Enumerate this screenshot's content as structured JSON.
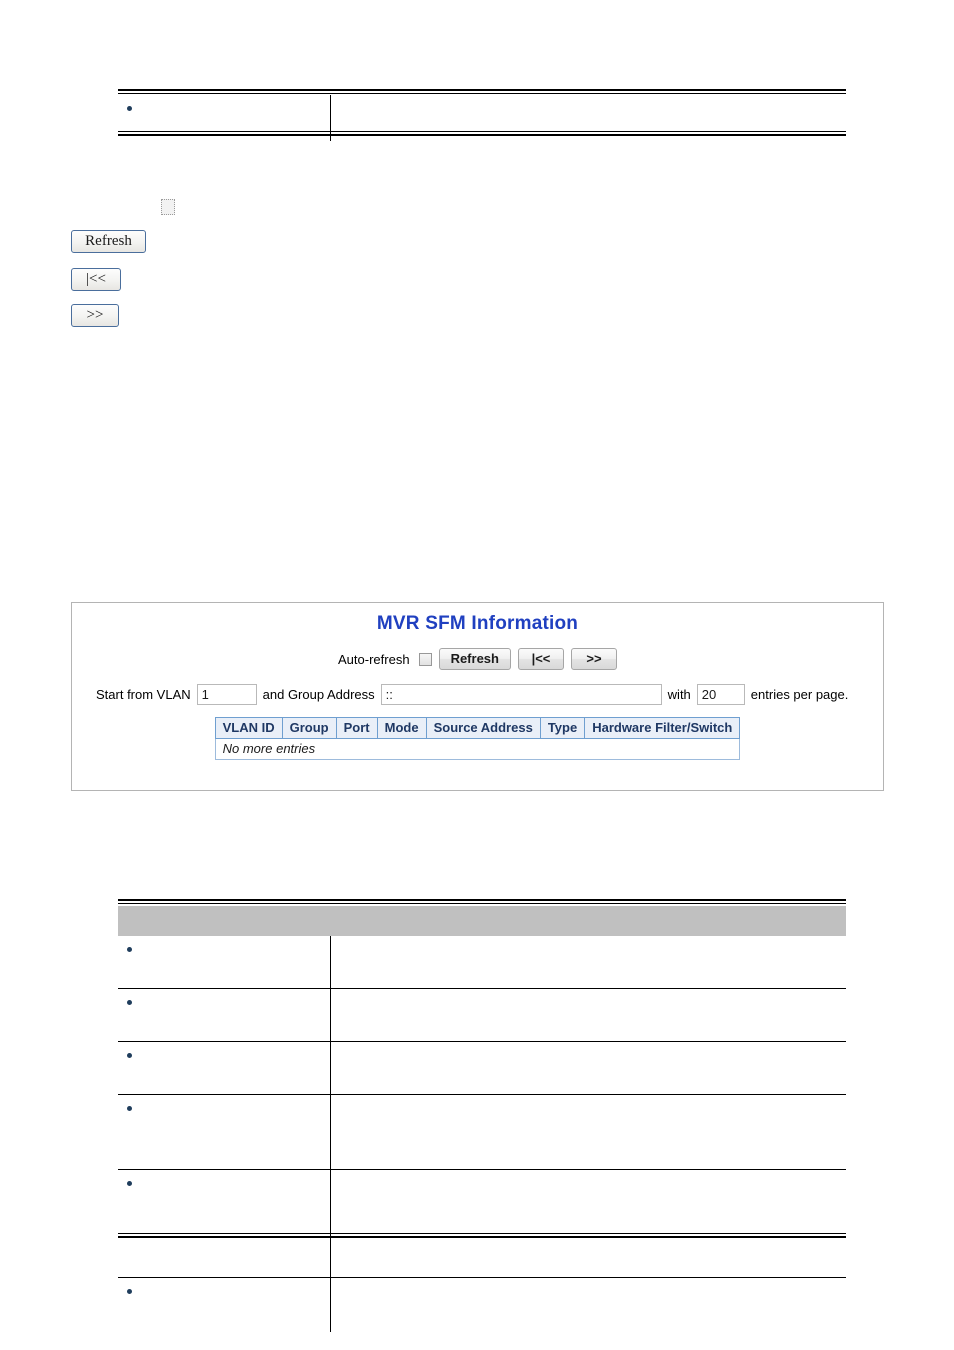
{
  "top_table": {
    "columns": [
      "",
      ""
    ],
    "rows": [
      {
        "label": "",
        "description": ""
      }
    ]
  },
  "top_controls": {
    "auto_refresh_checkbox": {
      "checked": false
    },
    "buttons": [
      {
        "name": "refresh",
        "label": "Refresh"
      },
      {
        "name": "first-page",
        "label": "|<<"
      },
      {
        "name": "next-page",
        "label": ">>"
      }
    ]
  },
  "mvr_panel": {
    "title": "MVR SFM Information",
    "toolbar": {
      "auto_refresh_label": "Auto-refresh",
      "auto_refresh_checked": false,
      "refresh_label": "Refresh",
      "first_label": "|<<",
      "next_label": ">>"
    },
    "filter_row": {
      "start_label": "Start from VLAN",
      "vlan_value": "1",
      "group_label": "and Group Address",
      "group_value": "::",
      "with_label": "with",
      "entries_value": "20",
      "entries_suffix": "entries per page."
    },
    "table": {
      "headers": [
        "VLAN ID",
        "Group",
        "Port",
        "Mode",
        "Source Address",
        "Type",
        "Hardware Filter/Switch"
      ],
      "empty_message": "No more entries"
    }
  },
  "bottom_table": {
    "header": {
      "col1": "",
      "col2": ""
    },
    "rows": [
      {
        "label": "",
        "description": ""
      },
      {
        "label": "",
        "description": ""
      },
      {
        "label": "",
        "description": ""
      },
      {
        "label": "",
        "description": ""
      },
      {
        "label": "",
        "description": ""
      },
      {
        "label": "",
        "description": ""
      }
    ]
  },
  "colors": {
    "title_blue": "#2040c0",
    "header_gray": "#c0c0c0",
    "bullet_navy": "#1f3d5c",
    "table_border_blue": "#4472a8",
    "th_background": "#e9eff8"
  }
}
